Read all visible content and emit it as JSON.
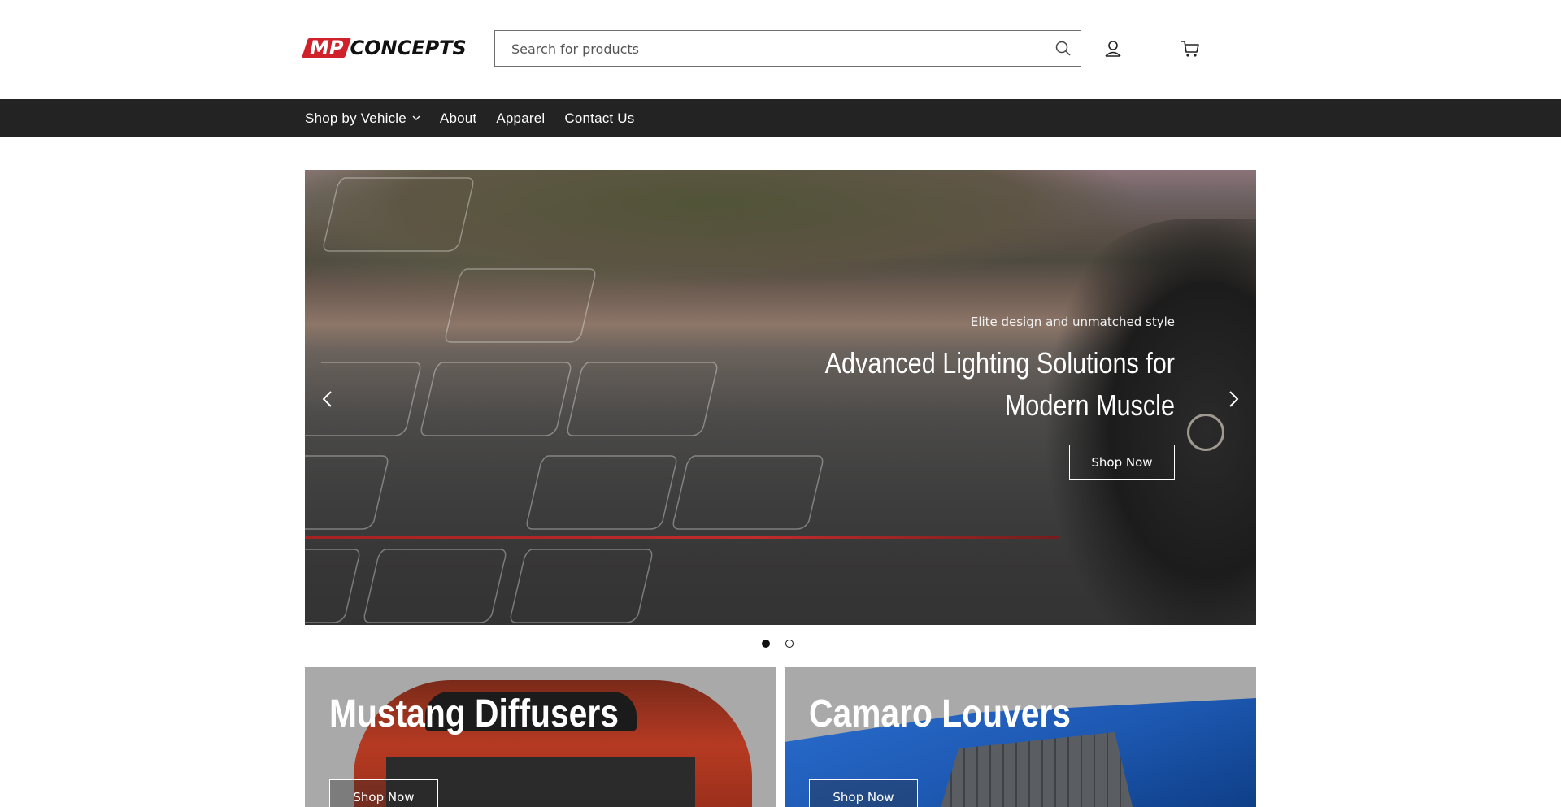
{
  "header": {
    "logo": {
      "part1": "MP",
      "part2": "CONCEPTS"
    },
    "search": {
      "placeholder": "Search for products"
    }
  },
  "nav": {
    "items": [
      {
        "label": "Shop by Vehicle",
        "has_dropdown": true
      },
      {
        "label": "About"
      },
      {
        "label": "Apparel"
      },
      {
        "label": "Contact Us"
      }
    ]
  },
  "hero": {
    "subtitle": "Elite design and unmatched style",
    "title": "Advanced Lighting Solutions for Modern Muscle",
    "button": "Shop Now",
    "slides": 2,
    "active_slide": 1
  },
  "cards": [
    {
      "title": "Mustang Diffusers",
      "button": "Shop Now"
    },
    {
      "title": "Camaro Louvers",
      "button": "Shop Now"
    }
  ],
  "colors": {
    "accent": "#d0202a",
    "nav_bg": "#232323"
  }
}
